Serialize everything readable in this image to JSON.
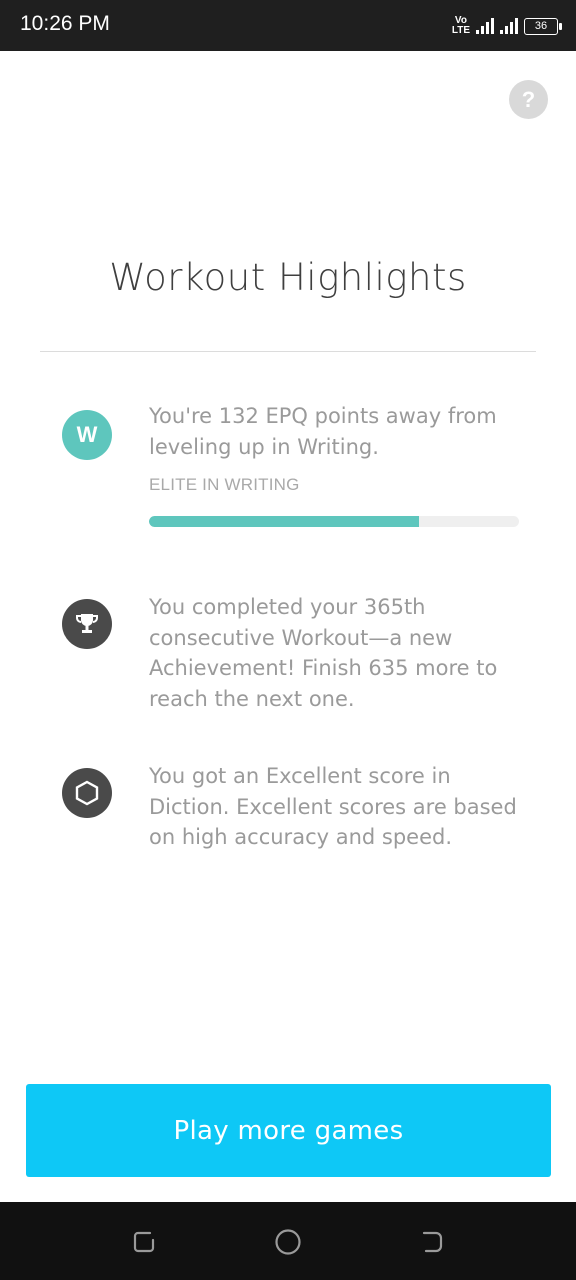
{
  "status_bar": {
    "time": "10:26 PM",
    "network_top": "Vo",
    "network_bottom": "LTE",
    "battery": "36"
  },
  "help_button": {
    "label": "?"
  },
  "title": "Workout Highlights",
  "highlights": [
    {
      "icon_letter": "W",
      "text": "You're 132 EPQ points away from leveling up in Writing.",
      "level_label": "ELITE IN WRITING",
      "progress": 0.73,
      "accent": "#5ec6bd"
    },
    {
      "icon": "trophy-icon",
      "text": "You completed your 365th consecutive Workout—a new Achievement! Finish 635 more to reach the next one."
    },
    {
      "icon": "hexagon-icon",
      "text": "You got an Excellent score in Diction. Excellent scores are based on high accuracy and speed."
    }
  ],
  "play_button": {
    "label": "Play more games",
    "color": "#0ec8f6"
  },
  "nav": {
    "icons": [
      "recent-apps-icon",
      "home-icon",
      "back-icon"
    ]
  }
}
